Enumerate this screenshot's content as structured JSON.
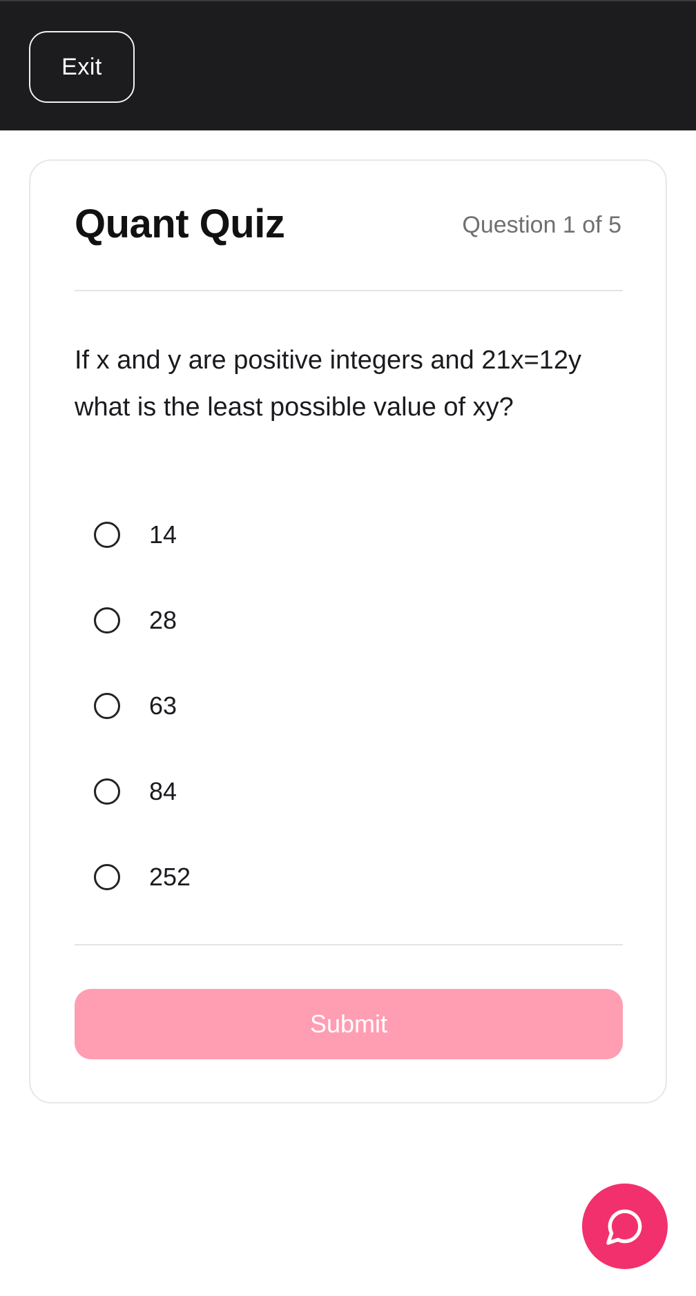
{
  "header": {
    "exit_label": "Exit"
  },
  "quiz": {
    "title": "Quant Quiz",
    "progress": "Question 1 of 5",
    "question": "If x and y are positive integers and 21x=12y what is the least possible value of xy?",
    "options": [
      "14",
      "28",
      "63",
      "84",
      "252"
    ],
    "submit_label": "Submit"
  },
  "chat": {
    "icon": "chat-bubble-icon"
  },
  "colors": {
    "topbar": "#1c1c1e",
    "submit_disabled": "#ff9db3",
    "accent": "#f2306d"
  }
}
